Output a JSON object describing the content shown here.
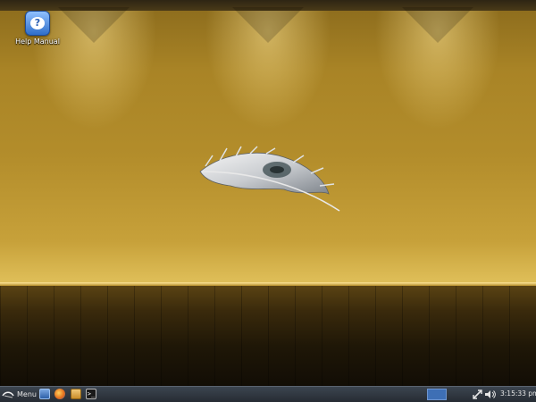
{
  "desktop": {
    "icons": [
      {
        "label": "Help Manual",
        "icon": "help-icon",
        "glyph": "?"
      }
    ],
    "wallpaper": {
      "description_colors": {
        "wall": "#b38d2b",
        "floor": "#2a1f0a",
        "glow": "#ffe79a"
      }
    }
  },
  "taskbar": {
    "menu_label": "Menu",
    "launchers": [
      {
        "icon": "show-desktop-icon"
      },
      {
        "icon": "firefox-icon"
      },
      {
        "icon": "file-manager-icon"
      },
      {
        "icon": "terminal-icon",
        "glyph": ">_"
      }
    ],
    "workspace_color": "#3e6fb5",
    "tray": {
      "network_icon": "network-icon",
      "volume_icon": "volume-icon"
    },
    "clock": "3:15:33 pm"
  }
}
